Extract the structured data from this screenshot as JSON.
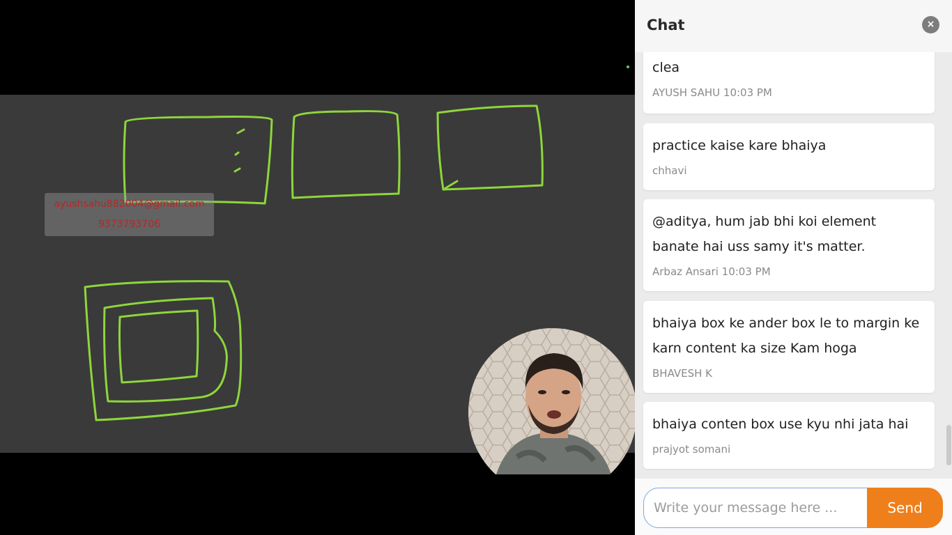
{
  "video": {
    "watermark": {
      "email": "ayushsahu882004@gmail.com",
      "phone": "9373793706"
    }
  },
  "chat": {
    "title": "Chat",
    "close_icon": "×",
    "messages": [
      {
        "text": "clea",
        "meta": "AYUSH SAHU 10:03 PM"
      },
      {
        "text": "practice kaise kare bhaiya",
        "meta": "chhavi"
      },
      {
        "text": "@aditya, hum jab bhi koi element banate hai uss samy it's matter.",
        "meta": "Arbaz Ansari 10:03 PM"
      },
      {
        "text": "bhaiya box ke ander box le to margin ke karn content ka size Kam hoga",
        "meta": "BHAVESH K"
      },
      {
        "text": "bhaiya conten box use kyu nhi jata hai",
        "meta": "prajyot somani"
      }
    ],
    "input": {
      "placeholder": "Write your message here ...",
      "value": ""
    },
    "send_label": "Send"
  },
  "colors": {
    "accent": "#ef7f1a",
    "sketch_stroke": "#8ed63c",
    "board": "#3a3a3a",
    "watermark_text": "#b12a2a"
  }
}
